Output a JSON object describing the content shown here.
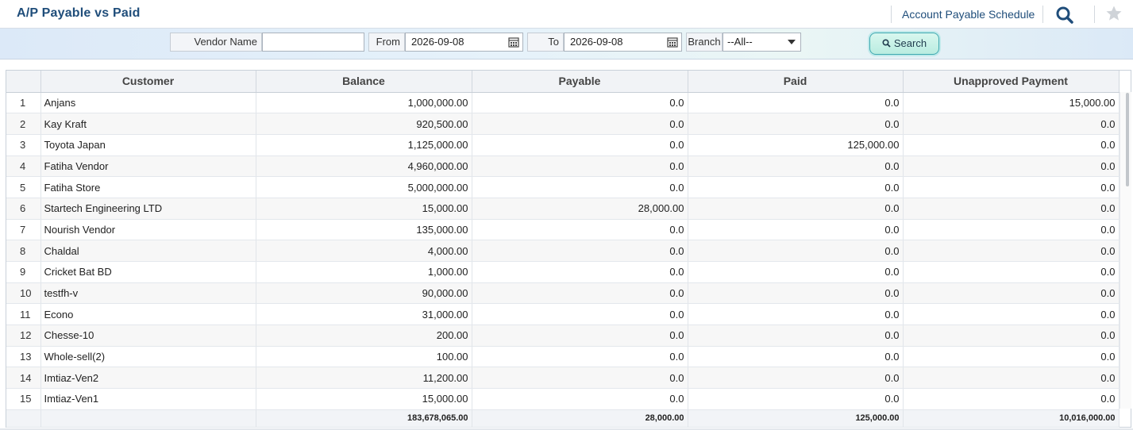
{
  "header": {
    "title": "A/P Payable vs Paid",
    "schedule_link": "Account Payable Schedule"
  },
  "filters": {
    "vendor_label": "Vendor Name",
    "vendor_value": "",
    "from_label": "From",
    "from_value": "2026-09-08",
    "to_label": "To",
    "to_value": "2026-09-08",
    "branch_label": "Branch",
    "branch_value": "--All--",
    "search_label": "Search"
  },
  "table": {
    "columns": [
      "Customer",
      "Balance",
      "Payable",
      "Paid",
      "Unapproved Payment"
    ],
    "rows": [
      {
        "n": "1",
        "customer": "Anjans",
        "balance": "1,000,000.00",
        "payable": "0.0",
        "paid": "0.0",
        "unapproved": "15,000.00"
      },
      {
        "n": "2",
        "customer": "Kay Kraft",
        "balance": "920,500.00",
        "payable": "0.0",
        "paid": "0.0",
        "unapproved": "0.0"
      },
      {
        "n": "3",
        "customer": "Toyota Japan",
        "balance": "1,125,000.00",
        "payable": "0.0",
        "paid": "125,000.00",
        "unapproved": "0.0"
      },
      {
        "n": "4",
        "customer": "Fatiha Vendor",
        "balance": "4,960,000.00",
        "payable": "0.0",
        "paid": "0.0",
        "unapproved": "0.0"
      },
      {
        "n": "5",
        "customer": "Fatiha Store",
        "balance": "5,000,000.00",
        "payable": "0.0",
        "paid": "0.0",
        "unapproved": "0.0"
      },
      {
        "n": "6",
        "customer": "Startech Engineering LTD",
        "balance": "15,000.00",
        "payable": "28,000.00",
        "paid": "0.0",
        "unapproved": "0.0"
      },
      {
        "n": "7",
        "customer": "Nourish Vendor",
        "balance": "135,000.00",
        "payable": "0.0",
        "paid": "0.0",
        "unapproved": "0.0"
      },
      {
        "n": "8",
        "customer": "Chaldal",
        "balance": "4,000.00",
        "payable": "0.0",
        "paid": "0.0",
        "unapproved": "0.0"
      },
      {
        "n": "9",
        "customer": "Cricket Bat BD",
        "balance": "1,000.00",
        "payable": "0.0",
        "paid": "0.0",
        "unapproved": "0.0"
      },
      {
        "n": "10",
        "customer": "testfh-v",
        "balance": "90,000.00",
        "payable": "0.0",
        "paid": "0.0",
        "unapproved": "0.0"
      },
      {
        "n": "11",
        "customer": "Econo",
        "balance": "31,000.00",
        "payable": "0.0",
        "paid": "0.0",
        "unapproved": "0.0"
      },
      {
        "n": "12",
        "customer": "Chesse-10",
        "balance": "200.00",
        "payable": "0.0",
        "paid": "0.0",
        "unapproved": "0.0"
      },
      {
        "n": "13",
        "customer": "Whole-sell(2)",
        "balance": "100.00",
        "payable": "0.0",
        "paid": "0.0",
        "unapproved": "0.0"
      },
      {
        "n": "14",
        "customer": "Imtiaz-Ven2",
        "balance": "11,200.00",
        "payable": "0.0",
        "paid": "0.0",
        "unapproved": "0.0"
      },
      {
        "n": "15",
        "customer": "Imtiaz-Ven1",
        "balance": "15,000.00",
        "payable": "0.0",
        "paid": "0.0",
        "unapproved": "0.0"
      }
    ],
    "totals": {
      "balance": "183,678,065.00",
      "payable": "28,000.00",
      "paid": "125,000.00",
      "unapproved": "10,016,000.00"
    }
  },
  "colors": {
    "title": "#1f4d7a",
    "accent_button": "#b9ece0"
  }
}
